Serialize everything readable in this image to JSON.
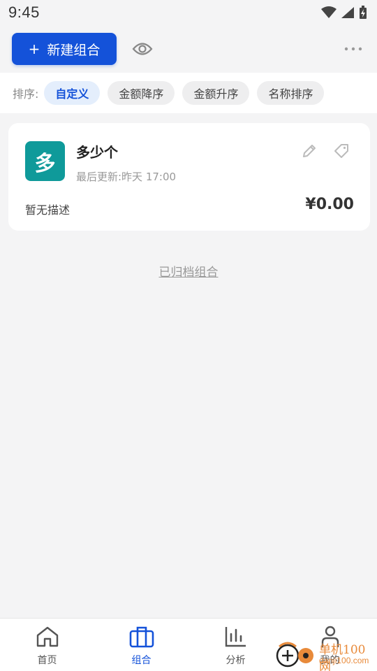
{
  "status_bar": {
    "time": "9:45"
  },
  "toolbar": {
    "new_button_icon": "plus-icon",
    "new_button_label": "新建组合",
    "eye_icon": "eye-icon",
    "more_icon": "more-horizontal-icon"
  },
  "sort": {
    "label": "排序:",
    "options": [
      "自定义",
      "金额降序",
      "金额升序",
      "名称排序"
    ],
    "selected": "自定义"
  },
  "portfolios": [
    {
      "avatar_char": "多",
      "avatar_color": "#0f9a9a",
      "name": "多少个",
      "updated": "最后更新:昨天 17:00",
      "description": "暂无描述",
      "amount": "¥0.00"
    }
  ],
  "archived_link": "已归档组合",
  "bottom_nav": {
    "items": [
      {
        "label": "首页",
        "icon": "home-icon"
      },
      {
        "label": "组合",
        "icon": "briefcase-icon"
      },
      {
        "label": "分析",
        "icon": "bar-chart-icon"
      },
      {
        "label": "我的",
        "icon": "user-icon"
      }
    ],
    "active": "组合"
  },
  "watermark": {
    "line1": "单机100网",
    "line2": "danji100.com"
  },
  "colors": {
    "accent": "#1452d9",
    "background": "#f4f4f5",
    "avatar": "#0f9a9a",
    "watermark": "#e88a3a"
  }
}
